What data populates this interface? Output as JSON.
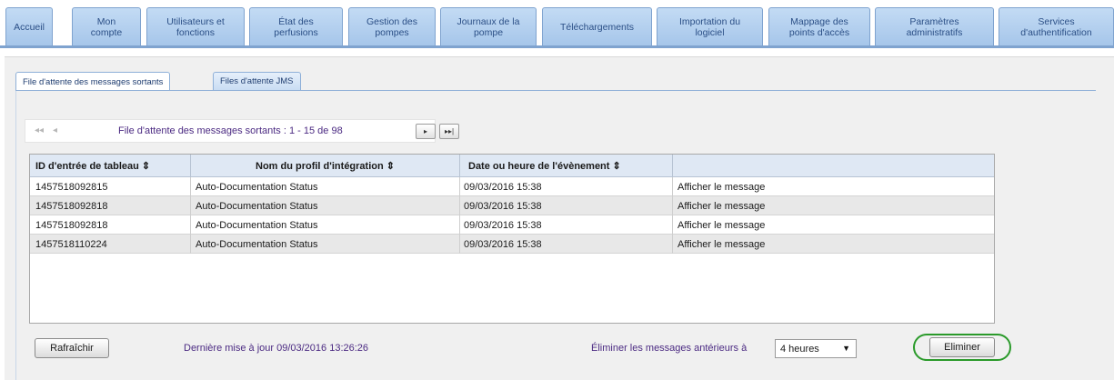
{
  "top_nav": {
    "tabs": [
      "Accueil",
      "Mon\ncompte",
      "Utilisateurs et\nfonctions",
      "État des\nperfusions",
      "Gestion des\npompes",
      "Journaux de la\npompe",
      "Téléchargements",
      "Importation du\nlogiciel",
      "Mappage des\npoints d'accès",
      "Paramètres\nadministratifs",
      "Services\nd'authentification"
    ]
  },
  "sub_tabs": {
    "active": "File d'attente des messages sortants",
    "other": "Files d'attente JMS"
  },
  "pager": {
    "first_icon": "double-left-arrow-icon",
    "prev_icon": "left-arrow-icon",
    "text": "File d'attente des messages sortants : 1 - 15 de 98",
    "next_icon": "▸",
    "last_icon": "▸▸|"
  },
  "table": {
    "columns": [
      "ID d'entrée de tableau ⇕",
      "Nom du profil d'intégration ⇕",
      "Date ou heure de l'évènement ⇕",
      ""
    ],
    "rows": [
      [
        "1457518092815",
        "Auto-Documentation Status",
        "09/03/2016 15:38",
        "Afficher le message"
      ],
      [
        "1457518092818",
        "Auto-Documentation Status",
        "09/03/2016 15:38",
        "Afficher le message"
      ],
      [
        "1457518092818",
        "Auto-Documentation Status",
        "09/03/2016 15:38",
        "Afficher le message"
      ],
      [
        "1457518110224",
        "Auto-Documentation Status",
        "09/03/2016 15:38",
        "Afficher le message"
      ]
    ]
  },
  "footer": {
    "refresh_label": "Rafraîchir",
    "last_update": "Dernière mise à jour 09/03/2016 13:26:26",
    "purge_label": "Éliminer les messages antérieurs à",
    "purge_select_value": "4 heures",
    "purge_button_label": "Eliminer"
  },
  "colors": {
    "tab_text": "#2b4f86",
    "link_purple": "#4b2a82",
    "highlight_green": "#2a9a2a",
    "header_bg": "#dfe8f4"
  }
}
